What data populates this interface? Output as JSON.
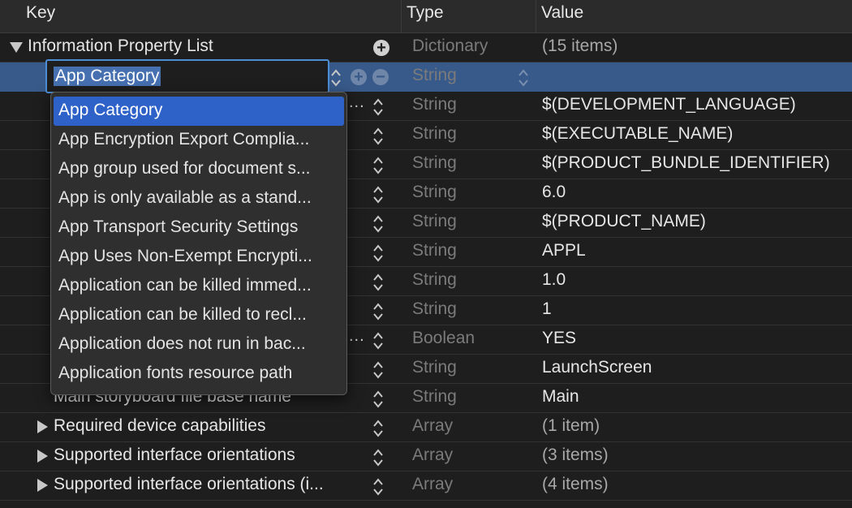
{
  "header": {
    "key": "Key",
    "type": "Type",
    "value": "Value"
  },
  "root": {
    "key": "Information Property List",
    "type": "Dictionary",
    "value": "(15 items)"
  },
  "editor": {
    "value": "App Category",
    "type": "String"
  },
  "rows": [
    {
      "type": "String",
      "value": "$(DEVELOPMENT_LANGUAGE)"
    },
    {
      "type": "String",
      "value": "$(EXECUTABLE_NAME)"
    },
    {
      "type": "String",
      "value": "$(PRODUCT_BUNDLE_IDENTIFIER)"
    },
    {
      "type": "String",
      "value": "6.0"
    },
    {
      "type": "String",
      "value": "$(PRODUCT_NAME)"
    },
    {
      "type": "String",
      "value": "APPL"
    },
    {
      "type": "String",
      "value": "1.0"
    },
    {
      "type": "String",
      "value": "1"
    },
    {
      "type": "Boolean",
      "value": "YES"
    },
    {
      "type": "String",
      "value": "LaunchScreen"
    },
    {
      "key": "Main storyboard file base name",
      "type": "String",
      "value": "Main"
    },
    {
      "key": "Required device capabilities",
      "type": "Array",
      "value": "(1 item)"
    },
    {
      "key": "Supported interface orientations",
      "type": "Array",
      "value": "(3 items)"
    },
    {
      "key": "Supported interface orientations (i...",
      "type": "Array",
      "value": "(4 items)"
    }
  ],
  "suggestions": [
    "App Category",
    "App Encryption Export Complia...",
    "App group used for document s...",
    "App is only available as a stand...",
    "App Transport Security Settings",
    "App Uses Non-Exempt Encrypti...",
    "Application can be killed immed...",
    "Application can be killed to recl...",
    "Application does not run in bac...",
    "Application fonts resource path"
  ],
  "colors": {
    "accent": "#2f62c9",
    "selected_row": "#385a8a",
    "background": "#1e1e1e"
  }
}
